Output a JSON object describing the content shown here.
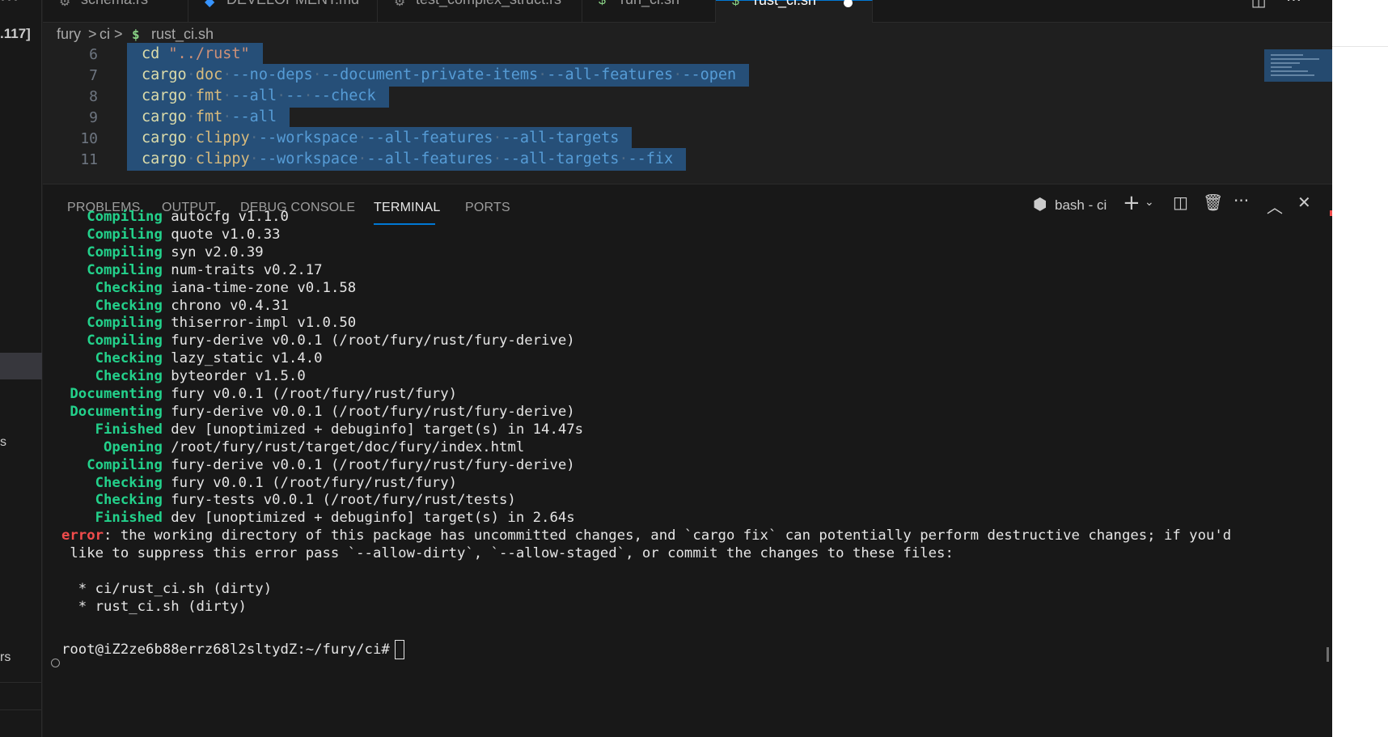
{
  "tabs": [
    {
      "icon": "rust-file-icon",
      "glyph": "⚙",
      "label": "schema.rs",
      "active": false
    },
    {
      "icon": "markdown-file-icon",
      "glyph": "◆",
      "label": "DEVELOPMENT.md",
      "active": false
    },
    {
      "icon": "rust-file-icon",
      "glyph": "⚙",
      "label": "test_complex_struct.rs",
      "active": false
    },
    {
      "icon": "shell-file-icon",
      "glyph": "$",
      "label": "run_ci.sh",
      "active": false
    },
    {
      "icon": "shell-file-icon",
      "glyph": "$",
      "label": "rust_ci.sh",
      "active": true,
      "modified": true
    }
  ],
  "sidebar": {
    "version_fragment": ".117]",
    "fragment_1": "s",
    "fragment_2": "rs"
  },
  "breadcrumb": {
    "items": [
      "fury",
      "ci",
      "rust_ci.sh"
    ],
    "separator": ">",
    "file_glyph": "$"
  },
  "editor": {
    "lines": [
      {
        "number": "6",
        "tokens": [
          [
            "cmd",
            "cd"
          ],
          [
            "plain",
            " "
          ],
          [
            "str",
            "\"../rust\""
          ]
        ]
      },
      {
        "number": "7",
        "tokens": [
          [
            "cmd",
            "cargo"
          ],
          [
            "plain",
            "·"
          ],
          [
            "kw",
            "doc"
          ],
          [
            "plain",
            "·"
          ],
          [
            "arg",
            "--no-deps"
          ],
          [
            "plain",
            "·"
          ],
          [
            "arg",
            "--document-private-items"
          ],
          [
            "plain",
            "·"
          ],
          [
            "arg",
            "--all-features"
          ],
          [
            "plain",
            "·"
          ],
          [
            "arg",
            "--open"
          ]
        ]
      },
      {
        "number": "8",
        "tokens": [
          [
            "cmd",
            "cargo"
          ],
          [
            "plain",
            "·"
          ],
          [
            "kw",
            "fmt"
          ],
          [
            "plain",
            "·"
          ],
          [
            "arg",
            "--all"
          ],
          [
            "plain",
            "·"
          ],
          [
            "arg",
            "--"
          ],
          [
            "plain",
            "·"
          ],
          [
            "arg",
            "--check"
          ]
        ]
      },
      {
        "number": "9",
        "tokens": [
          [
            "cmd",
            "cargo"
          ],
          [
            "plain",
            "·"
          ],
          [
            "kw",
            "fmt"
          ],
          [
            "plain",
            "·"
          ],
          [
            "arg",
            "--all"
          ]
        ]
      },
      {
        "number": "10",
        "tokens": [
          [
            "cmd",
            "cargo"
          ],
          [
            "plain",
            "·"
          ],
          [
            "kw",
            "clippy"
          ],
          [
            "plain",
            "·"
          ],
          [
            "arg",
            "--workspace"
          ],
          [
            "plain",
            "·"
          ],
          [
            "arg",
            "--all-features"
          ],
          [
            "plain",
            "·"
          ],
          [
            "arg",
            "--all-targets"
          ]
        ]
      },
      {
        "number": "11",
        "tokens": [
          [
            "cmd",
            "cargo"
          ],
          [
            "plain",
            "·"
          ],
          [
            "kw",
            "clippy"
          ],
          [
            "plain",
            "·"
          ],
          [
            "arg",
            "--workspace"
          ],
          [
            "plain",
            "·"
          ],
          [
            "arg",
            "--all-features"
          ],
          [
            "plain",
            "·"
          ],
          [
            "arg",
            "--all-targets"
          ],
          [
            "plain",
            "·"
          ],
          [
            "arg",
            "--fix"
          ]
        ]
      }
    ]
  },
  "panel": {
    "tabs": [
      "PROBLEMS",
      "OUTPUT",
      "DEBUG CONSOLE",
      "TERMINAL",
      "PORTS"
    ],
    "active_tab": "TERMINAL",
    "terminal_name": "bash - ci",
    "actions": [
      "new-terminal",
      "split-terminal",
      "kill-terminal",
      "more-actions",
      "maximize-panel",
      "close-panel"
    ]
  },
  "terminal": {
    "lines": [
      {
        "pad": "   ",
        "status": "Compiling",
        "text": " autocfg v1.1.0"
      },
      {
        "pad": "   ",
        "status": "Compiling",
        "text": " quote v1.0.33"
      },
      {
        "pad": "   ",
        "status": "Compiling",
        "text": " syn v2.0.39"
      },
      {
        "pad": "   ",
        "status": "Compiling",
        "text": " num-traits v0.2.17"
      },
      {
        "pad": "    ",
        "status": "Checking",
        "text": " iana-time-zone v0.1.58"
      },
      {
        "pad": "    ",
        "status": "Checking",
        "text": " chrono v0.4.31"
      },
      {
        "pad": "   ",
        "status": "Compiling",
        "text": " thiserror-impl v1.0.50"
      },
      {
        "pad": "   ",
        "status": "Compiling",
        "text": " fury-derive v0.0.1 (/root/fury/rust/fury-derive)"
      },
      {
        "pad": "    ",
        "status": "Checking",
        "text": " lazy_static v1.4.0"
      },
      {
        "pad": "    ",
        "status": "Checking",
        "text": " byteorder v1.5.0"
      },
      {
        "pad": " ",
        "status": "Documenting",
        "text": " fury v0.0.1 (/root/fury/rust/fury)"
      },
      {
        "pad": " ",
        "status": "Documenting",
        "text": " fury-derive v0.0.1 (/root/fury/rust/fury-derive)"
      },
      {
        "pad": "    ",
        "status": "Finished",
        "text": " dev [unoptimized + debuginfo] target(s) in 14.47s"
      },
      {
        "pad": "     ",
        "status": "Opening",
        "text": " /root/fury/rust/target/doc/fury/index.html"
      },
      {
        "pad": "   ",
        "status": "Compiling",
        "text": " fury-derive v0.0.1 (/root/fury/rust/fury-derive)"
      },
      {
        "pad": "    ",
        "status": "Checking",
        "text": " fury v0.0.1 (/root/fury/rust/fury)"
      },
      {
        "pad": "    ",
        "status": "Checking",
        "text": " fury-tests v0.0.1 (/root/fury/rust/tests)"
      },
      {
        "pad": "    ",
        "status": "Finished",
        "text": " dev [unoptimized + debuginfo] target(s) in 2.64s"
      }
    ],
    "error_label": "error",
    "error_line_1": ": the working directory of this package has uncommitted changes, and `cargo fix` can potentially perform destructive changes; if you'd",
    "error_line_2": " like to suppress this error pass `--allow-dirty`, `--allow-staged`, or commit the changes to these files:",
    "dirty_files": [
      "  * ci/rust_ci.sh (dirty)",
      "  * rust_ci.sh (dirty)"
    ],
    "prompt": "root@iZ2ze6b88errz68l2sltydZ:~/fury/ci#"
  },
  "colors": {
    "selection": "#264f78",
    "terminal_green": "#23d18b",
    "terminal_error": "#f14c4c",
    "accent": "#0078d4"
  }
}
